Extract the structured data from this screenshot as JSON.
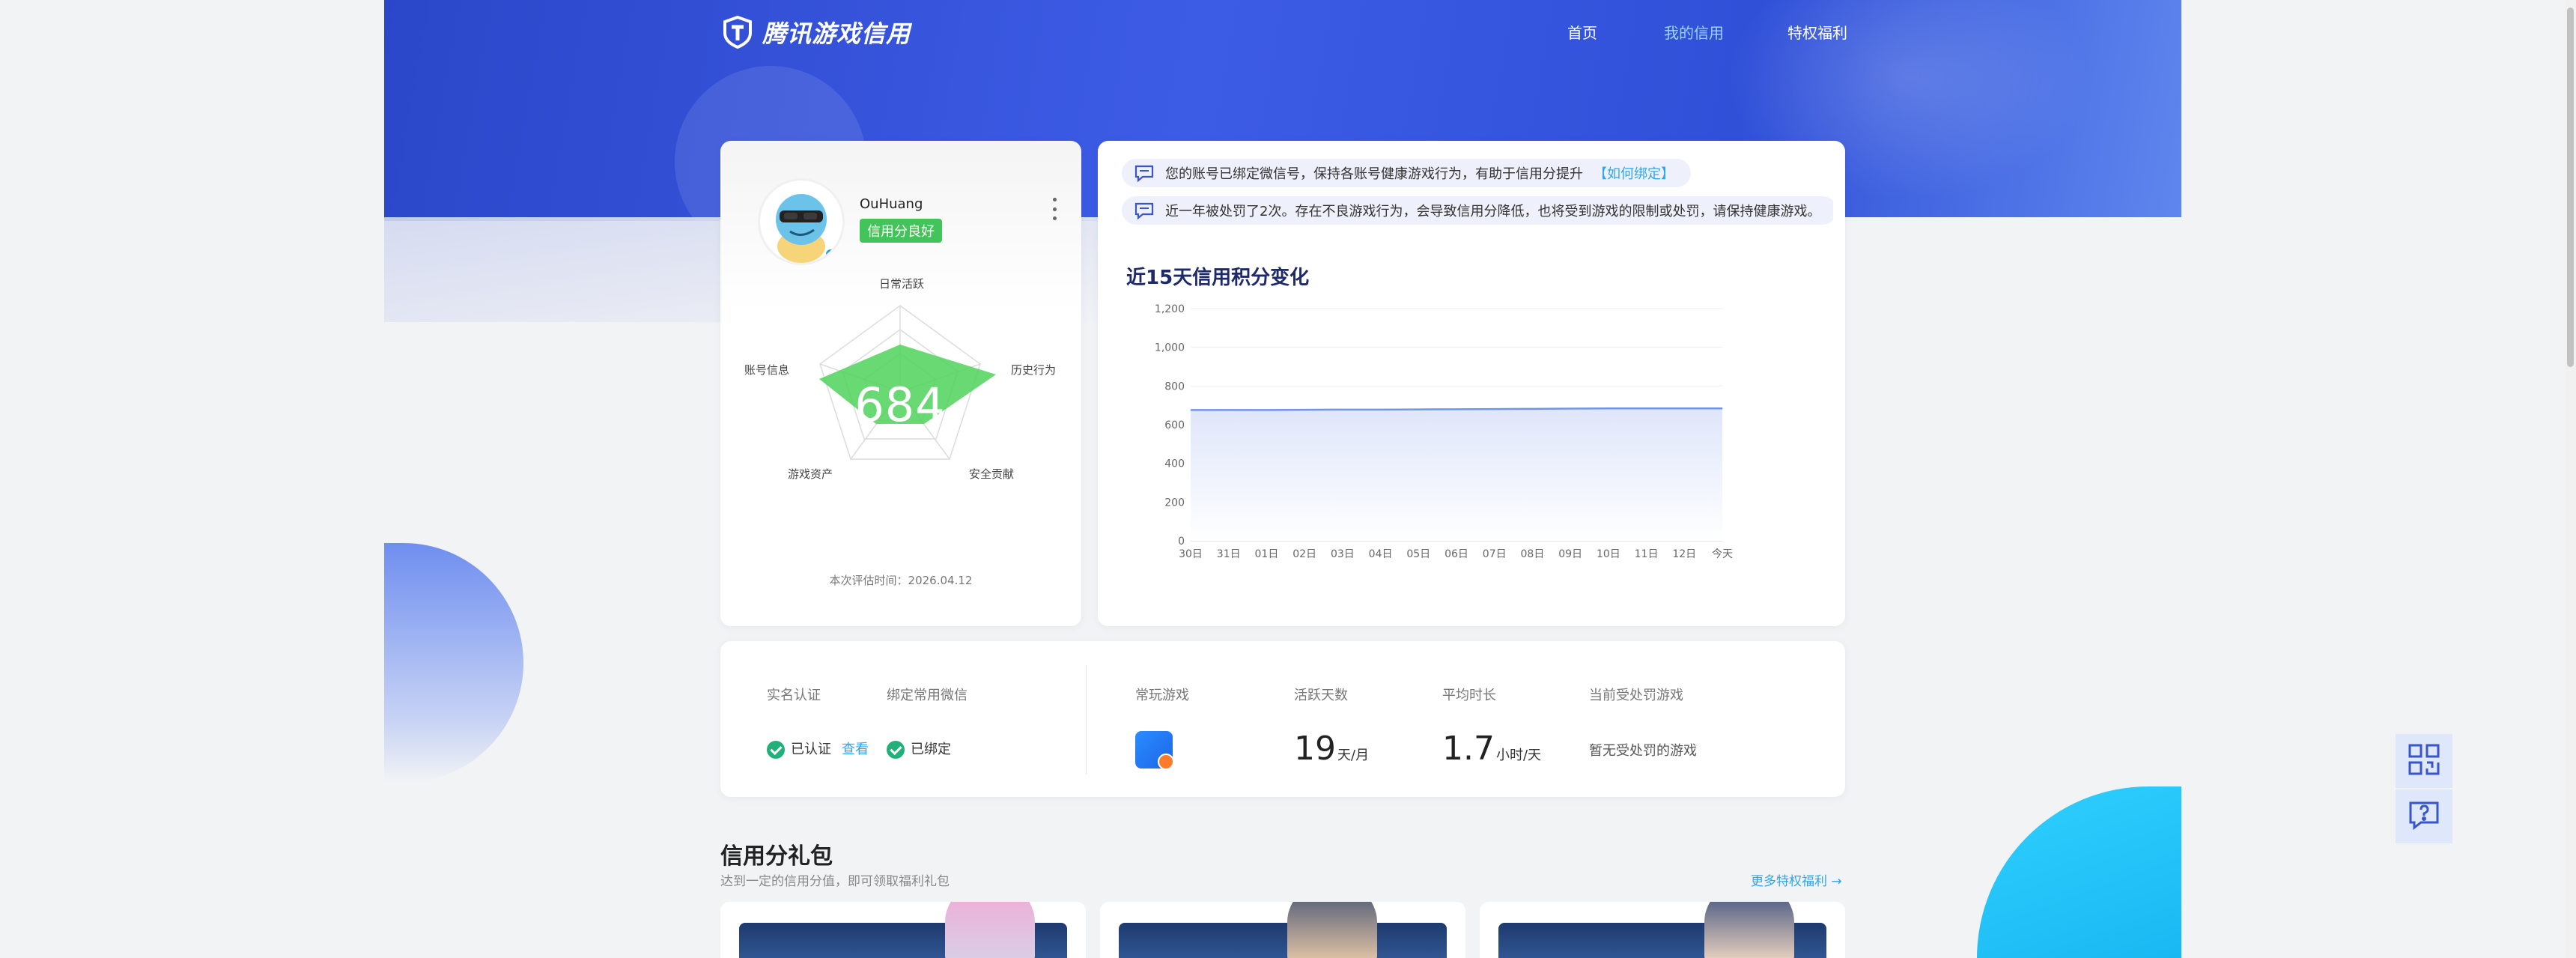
{
  "brand": {
    "name": "腾讯游戏信用"
  },
  "nav": {
    "items": [
      {
        "label": "首页",
        "active": false
      },
      {
        "label": "我的信用",
        "active": true
      },
      {
        "label": "特权福利",
        "active": false
      }
    ]
  },
  "profile": {
    "username": "OuHuang",
    "credit_badge": "信用分良好",
    "score": "684",
    "radar_labels": {
      "top": "日常活跃",
      "right": "历史行为",
      "bottom_right": "安全贡献",
      "bottom_left": "游戏资产",
      "left": "账号信息"
    },
    "eval_time": "本次评估时间：2026.04.12"
  },
  "notices": [
    {
      "text": "您的账号已绑定微信号，保持各账号健康游戏行为，有助于信用分提升",
      "link": "【如何绑定】"
    },
    {
      "text": "近一年被处罚了2次。存在不良游戏行为，会导致信用分降低，也将受到游戏的限制或处罚，请保持健康游戏。",
      "link": ""
    }
  ],
  "chart_title": "近15天信用积分变化",
  "chart_data": {
    "type": "area",
    "title": "近15天信用积分变化",
    "categories": [
      "30日",
      "31日",
      "01日",
      "02日",
      "03日",
      "04日",
      "05日",
      "06日",
      "07日",
      "08日",
      "09日",
      "10日",
      "11日",
      "12日",
      "今天"
    ],
    "values": [
      676,
      676,
      676,
      677,
      678,
      678,
      679,
      680,
      681,
      682,
      683,
      684,
      684,
      684,
      684
    ],
    "ylim": [
      0,
      1200
    ],
    "yticks": [
      "0",
      "200",
      "400",
      "600",
      "800",
      "1,000",
      "1,200"
    ],
    "grid": true,
    "colors": {
      "line": "#6f95e8",
      "fill": "#dfe6fa"
    }
  },
  "stats": {
    "realname": {
      "label": "实名认证",
      "value": "已认证",
      "link": "查看"
    },
    "wechat": {
      "label": "绑定常用微信",
      "value": "已绑定"
    },
    "games": {
      "label": "常玩游戏"
    },
    "active_days": {
      "label": "活跃天数",
      "value": "19",
      "unit": "天/月"
    },
    "avg_time": {
      "label": "平均时长",
      "value": "1.7",
      "unit": "小时/天"
    },
    "punished": {
      "label": "当前受处罚游戏",
      "value": "暂无受处罚的游戏"
    }
  },
  "gift_section": {
    "title": "信用分礼包",
    "subtitle": "达到一定的信用分值，即可领取福利礼包",
    "more": "更多特权福利 →"
  },
  "side_buttons": {
    "qr": "qr-code-icon",
    "help": "help-chat-icon"
  },
  "colors": {
    "brand_blue": "#3050d8",
    "accent": "#2fa6ec",
    "success": "#22b07a",
    "badge_green": "#43c45a"
  }
}
